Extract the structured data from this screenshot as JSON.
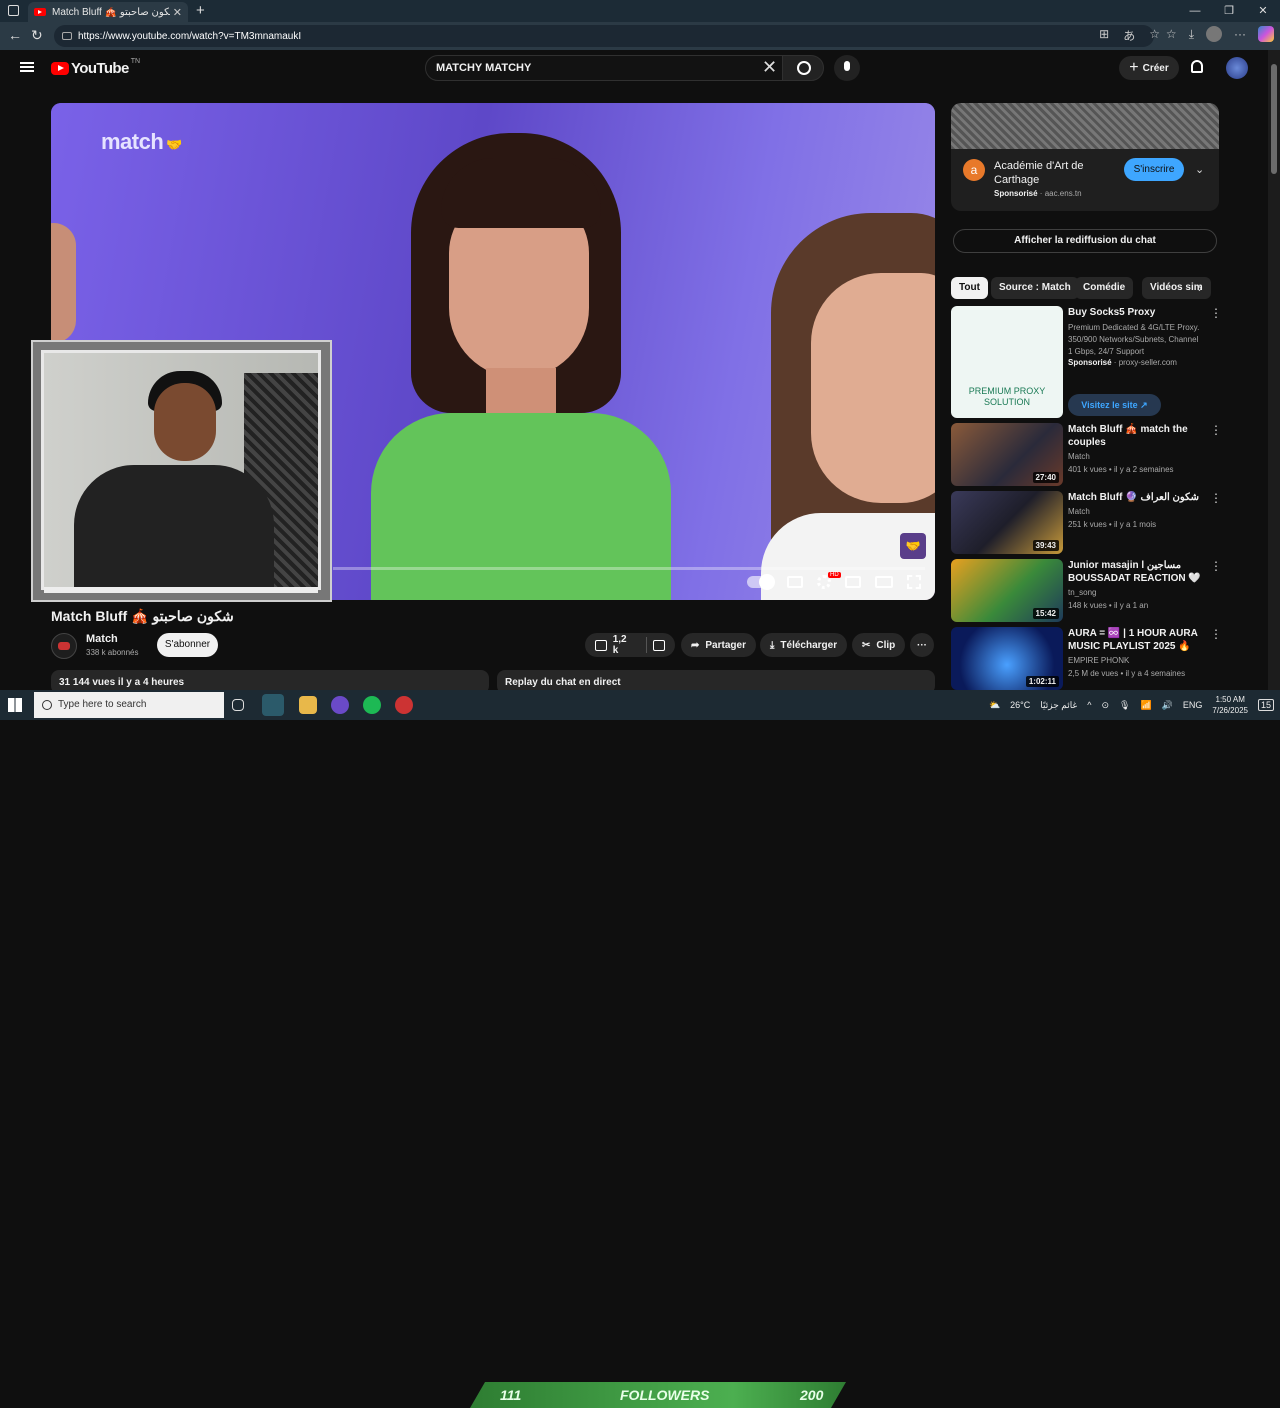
{
  "browser": {
    "tab_title": "Match Bluff 🎪 شكون صاحبتو - Yo",
    "url": "https://www.youtube.com/watch?v=TM3mnamaukI"
  },
  "masthead": {
    "brand": "YouTube",
    "country": "TN",
    "search_query": "MATCHY MATCHY",
    "create_label": "Créer"
  },
  "video": {
    "title": "Match Bluff 🎪 شكون صاحبتو",
    "channel": "Match",
    "subscribers": "338 k abonnés",
    "subscribe_label": "S'abonner",
    "likes": "1,2 k",
    "share_label": "Partager",
    "download_label": "Télécharger",
    "clip_label": "Clip",
    "views_line": "31 144 vues  il y a 4 heures",
    "chat_replay": "Replay du chat en direct",
    "overlay_logo": "match",
    "hd_badge": "HD"
  },
  "sidebar": {
    "ad": {
      "logo_letter": "a",
      "name": "Académie d'Art de Carthage",
      "sponsored": "Sponsorisé",
      "domain": "aac.ens.tn",
      "subscribe_label": "S'inscrire"
    },
    "live_chat_label": "Afficher la rediffusion du chat",
    "chips": [
      "Tout",
      "Source : Match",
      "Comédie",
      "Vidéos sim"
    ],
    "proxy_ad": {
      "title": "Buy Socks5 Proxy",
      "description": "Premium Dedicated & 4G/LTE Proxy. 350/900 Networks/Subnets, Channel 1 Gbps, 24/7 Support",
      "sponsored": "Sponsorisé",
      "domain": "proxy-seller.com",
      "thumb_text": "PREMIUM PROXY SOLUTION",
      "visit_label": "Visitez le site"
    },
    "recommendations": [
      {
        "title": "Match Bluff 🎪 match the couples",
        "channel": "Match",
        "meta": "401 k vues • il y a 2 semaines",
        "duration": "27:40"
      },
      {
        "title": "Match Bluff 🔮 شكون العراف",
        "channel": "Match",
        "meta": "251 k vues • il y a 1 mois",
        "duration": "39:43"
      },
      {
        "title": "Junior  masajin l مساجين BOUSSADAT REACTION 🤍",
        "channel": "tn_song",
        "meta": "148 k vues • il y a 1 an",
        "duration": "15:42"
      },
      {
        "title": "AURA = ♾️ | 1 HOUR AURA MUSIC PLAYLIST 2025 🔥",
        "channel": "EMPIRE PHONK",
        "meta": "2,5 M de vues • il y a 4 semaines",
        "duration": "1:02:11"
      }
    ]
  },
  "taskbar": {
    "search_placeholder": "Type here to search",
    "followers_left": "111",
    "followers_label": "FOLLOWERS",
    "followers_right": "200",
    "weather": "26°C",
    "weather_text": "غائم جزئيًا",
    "lang": "ENG",
    "time": "1:50 AM",
    "date": "7/26/2025",
    "notif_count": "15"
  },
  "colors": {
    "accent_red": "#ff0000",
    "subscribe_blue": "#3ea6ff",
    "followers_green": "#4caf50"
  }
}
